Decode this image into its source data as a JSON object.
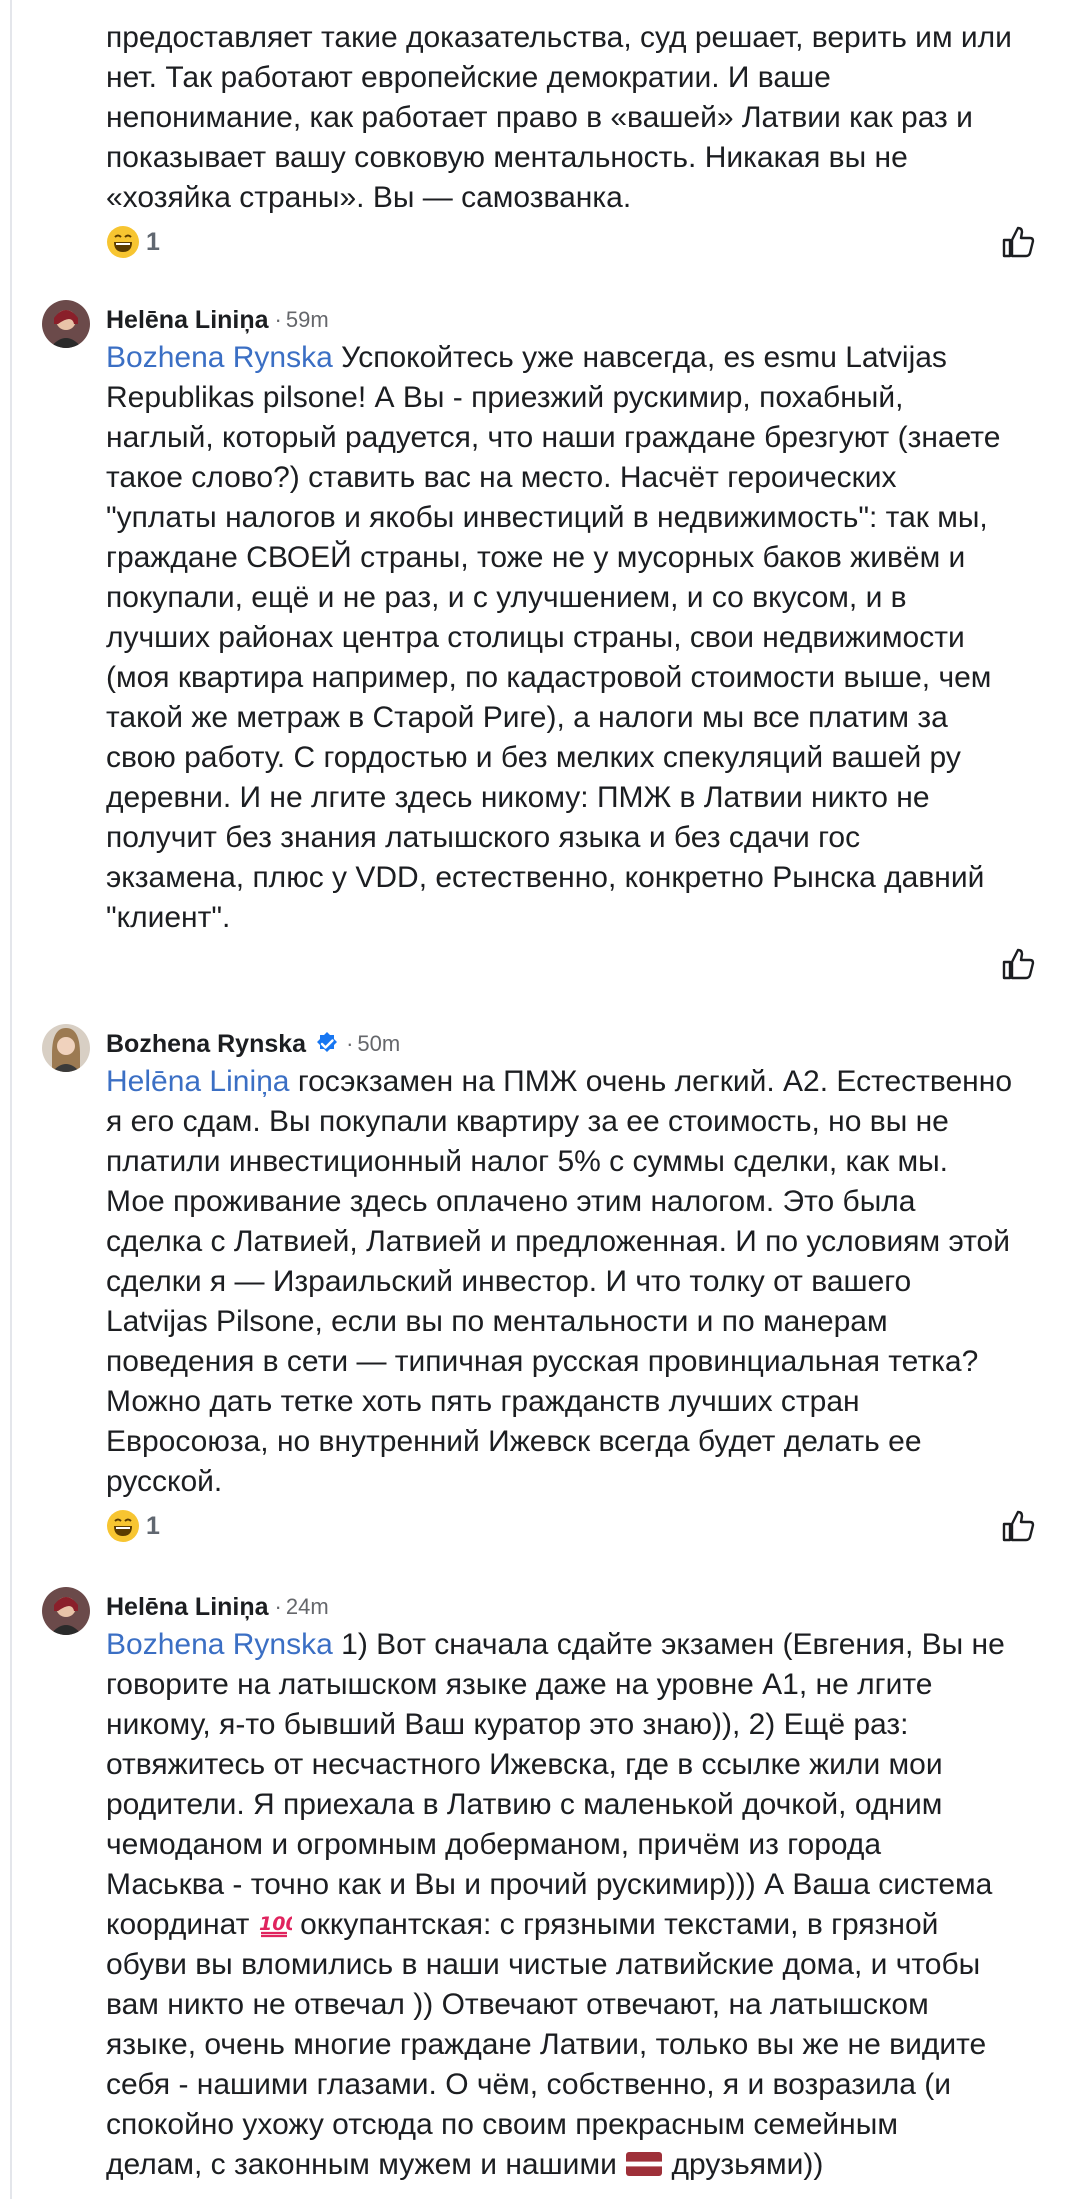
{
  "top_comment": {
    "lines": [
      "предоставляет такие доказательства, суд решает, верить им или",
      "нет. Так работают европейские демократии. И ваше",
      "непонимание, как работает право в «вашей» Латвии как раз и",
      "показывает вашу совковую ментальность. Никакая вы не",
      "«хозяйка страны». Вы — самозванка."
    ],
    "reaction_count": "1"
  },
  "comments": [
    {
      "author": "Helēna Liniņa",
      "sep": "·",
      "time": "59m",
      "mention": "Bozhena  Rynska",
      "first_line_rest": " Успокойтесь уже навсегда, es esmu Latvijas",
      "lines": [
        "Republikas pilsone! А Вы - приезжий рускимир, похабный,",
        "наглый, который радуется, что наши граждане брезгуют (знаете",
        "такое слово?) ставить вас на место. Насчёт героических",
        "\"уплаты налогов и якобы инвестиций в недвижимость\": так мы,",
        "граждане СВОЕЙ страны, тоже не у мусорных баков живём и",
        "покупали, ещё и не раз, и с улучшением, и со вкусом, и в",
        "лучших районах центра столицы страны, свои недвижимости",
        "(моя квартира например, по кадастровой стоимости выше, чем",
        "такой же метраж в Старой Риге), а налоги мы все платим за",
        "свою работу. С гордостью и без мелких спекуляций вашей ру",
        "деревни. И не лгите здесь никому: ПМЖ в Латвии никто не",
        "получит без знания латышского языка и без сдачи гос",
        "экзамена, плюс у VDD, естественно, конкретно Рынска давний",
        "\"клиент\"."
      ]
    },
    {
      "author": "Bozhena  Rynska",
      "sep": "·",
      "time": "50m",
      "mention": "Helēna Liniņa",
      "first_line_rest": " госэкзамен на ПМЖ очень легкий. А2. Естественно",
      "lines": [
        "я его сдам. Вы покупали квартиру за ее стоимость, но вы не",
        "платили инвестиционный налог 5% с суммы сделки, как мы.",
        "Мое проживание здесь оплачено этим налогом. Это была",
        "сделка с Латвией, Латвией и предложенная. И по условиям этой",
        "сделки я — Израильский инвестор. И что толку от вашего",
        "Latvijas Pilsone, если вы по ментальности и по манерам",
        "поведения в сети — типичная русская провинциальная тетка?",
        "Можно дать тетке хоть пять гражданств лучших стран",
        "Евросоюза, но внутренний Ижевск всегда будет делать ее",
        "русской."
      ],
      "reaction_count": "1"
    },
    {
      "author": "Helēna Liniņa",
      "sep": "·",
      "time": "24m",
      "mention": "Bozhena  Rynska",
      "first_line_rest": " 1) Вот сначала сдайте экзамен (Евгения, Вы не",
      "lines": [
        "говорите на латышском языке даже на уровне А1, не лгите",
        "никому, я-то бывший Ваш куратор это знаю)), 2) Ещё раз:",
        "отвяжитесь от несчастного Ижевска, где в ссылке жили мои",
        "родители. Я приехала в Латвию с маленькой дочкой, одним",
        "чемоданом и огромным доберманом, причём из города",
        "Маськва - точно как и Вы и прочий рускимир))) А Ваша система"
      ],
      "line_emoji_before": "координат ",
      "line_emoji_after": " оккупантская: с грязными текстами, в грязной",
      "lines_after": [
        "обуви вы вломились в наши чистые латвийские дома, и чтобы",
        "вам никто не отвечал )) Отвечают отвечают, на латышском",
        "языке, очень многие граждане Латвии, только вы же не видите",
        "себя - нашими глазами. О чём, собственно, я и возразила (и",
        "спокойно ухожу отсюда по своим прекрасным семейным"
      ],
      "last_before": "делам, с законным мужем и нашими ",
      "last_after": " друзьями))"
    }
  ],
  "icons": {
    "reaction": "laughing-emoji-icon",
    "like": "thumbs-up-icon",
    "verified": "verified-badge-icon",
    "hundred": "hundred-points-emoji-icon",
    "flag": "latvia-flag-emoji-icon"
  },
  "colors": {
    "mention": "#3b6fc4",
    "verified": "#1877f2",
    "meta": "#65676b"
  }
}
